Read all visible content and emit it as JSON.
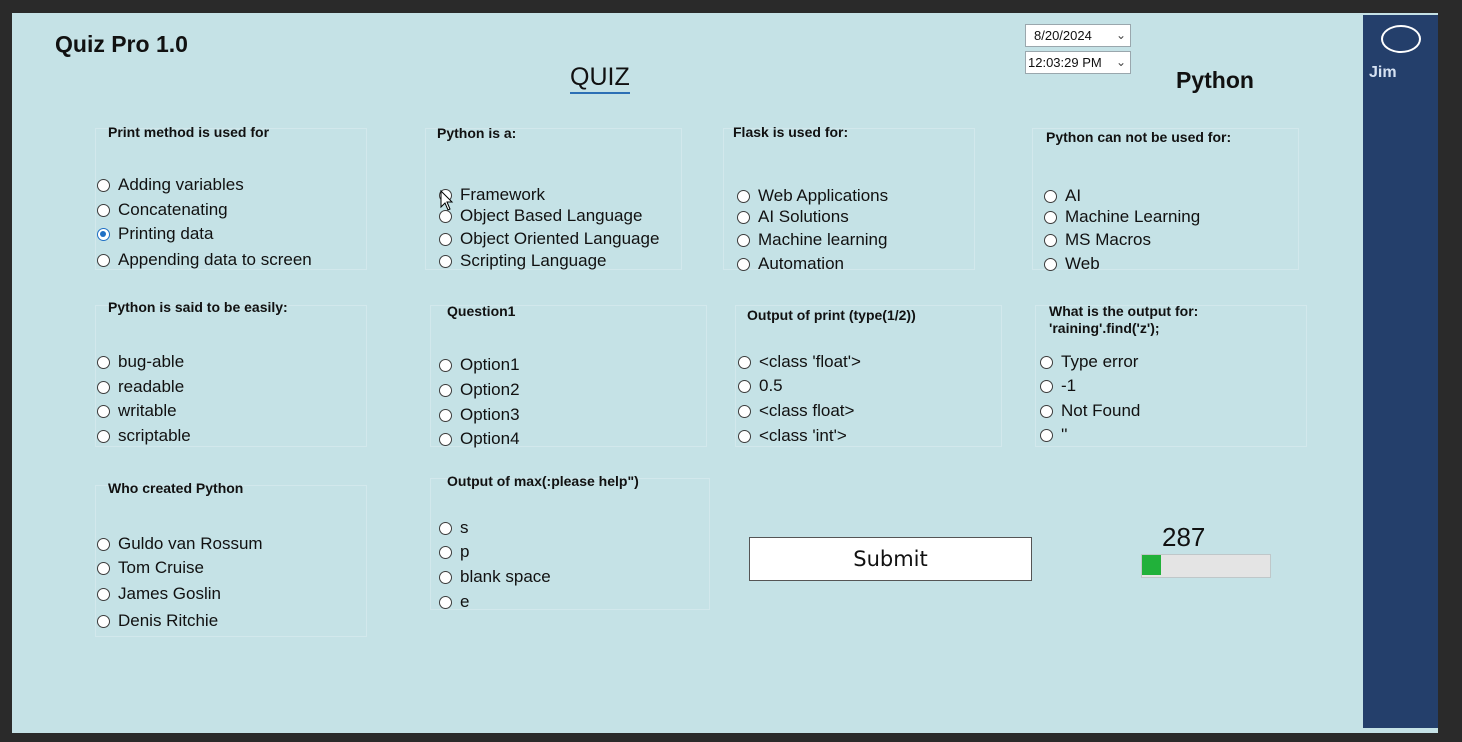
{
  "app": {
    "title": "Quiz Pro 1.0",
    "heading": "QUIZ",
    "subject": "Python"
  },
  "pickers": {
    "date": "8/20/2024",
    "time": "12:03:29 PM"
  },
  "user": {
    "name": "Jim"
  },
  "questions": [
    {
      "title": "Print method is used for",
      "options": [
        "Adding variables",
        "Concatenating",
        "Printing data",
        "Appending data to screen"
      ],
      "selected": 2
    },
    {
      "title": "Python is a:",
      "options": [
        "Framework",
        "Object Based Language",
        "Object Oriented Language",
        "Scripting Language"
      ],
      "selected": -1
    },
    {
      "title": "Flask is used for:",
      "options": [
        "Web Applications",
        "AI Solutions",
        "Machine learning",
        "Automation"
      ],
      "selected": -1
    },
    {
      "title": "Python can not be used for:",
      "options": [
        "AI",
        "Machine Learning",
        "MS Macros",
        "Web"
      ],
      "selected": -1
    },
    {
      "title": "Python is said to be easily:",
      "options": [
        "bug-able",
        "readable",
        "writable",
        "scriptable"
      ],
      "selected": -1
    },
    {
      "title": "Question1",
      "options": [
        "Option1",
        "Option2",
        "Option3",
        "Option4"
      ],
      "selected": -1
    },
    {
      "title": "Output of print (type(1/2))",
      "options": [
        "<class 'float'>",
        "0.5",
        "<class float>",
        "<class 'int'>"
      ],
      "selected": -1
    },
    {
      "title": "What is the output for:\n'raining'.find('z');",
      "options": [
        "Type error",
        "-1",
        "Not Found",
        "''"
      ],
      "selected": -1
    },
    {
      "title": "Who created Python",
      "options": [
        "Guldo van Rossum",
        "Tom Cruise",
        "James Goslin",
        "Denis Ritchie"
      ],
      "selected": -1
    },
    {
      "title": "Output of max(:please help\")",
      "options": [
        "s",
        "p",
        "blank space",
        "e"
      ],
      "selected": -1
    }
  ],
  "submit_label": "Submit",
  "timer": {
    "value": "287",
    "progress_fraction": 0.15
  },
  "icons": {
    "cursor": "mouse-cursor-icon",
    "avatar": "avatar-icon"
  },
  "colors": {
    "background": "#c5e2e6",
    "sidebar": "#243f6b",
    "progress": "#21b13a",
    "radio_selected": "#1f6fc4"
  }
}
